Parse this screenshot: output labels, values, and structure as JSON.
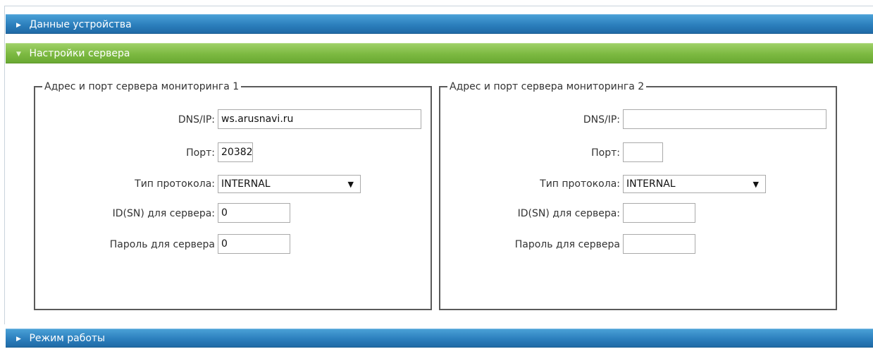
{
  "sections": {
    "device_data": "Данные устройства",
    "server_settings": "Настройки сервера",
    "work_mode": "Режим работы"
  },
  "group1": {
    "legend": "Адрес и порт сервера мониторинга 1",
    "dns_label": "DNS/IP:",
    "dns_value": "ws.arusnavi.ru",
    "port_label": "Порт:",
    "port_value": "20382",
    "protocol_label": "Тип протокола:",
    "protocol_value": "INTERNAL",
    "id_label": "ID(SN) для сервера:",
    "id_value": "0",
    "password_label": "Пароль для сервера",
    "password_value": "0"
  },
  "group2": {
    "legend": "Адрес и порт сервера мониторинга 2",
    "dns_label": "DNS/IP:",
    "dns_value": "",
    "port_label": "Порт:",
    "port_value": "",
    "protocol_label": "Тип протокола:",
    "protocol_value": "INTERNAL",
    "id_label": "ID(SN) для сервера:",
    "id_value": "",
    "password_label": "Пароль для сервера",
    "password_value": ""
  },
  "icons": {
    "collapsed": "caret-right-icon",
    "expanded": "caret-down-icon",
    "dropdown": "dropdown-arrow-icon"
  },
  "colors": {
    "blue_bar": "#2c7fbd",
    "green_bar": "#7cb941"
  }
}
